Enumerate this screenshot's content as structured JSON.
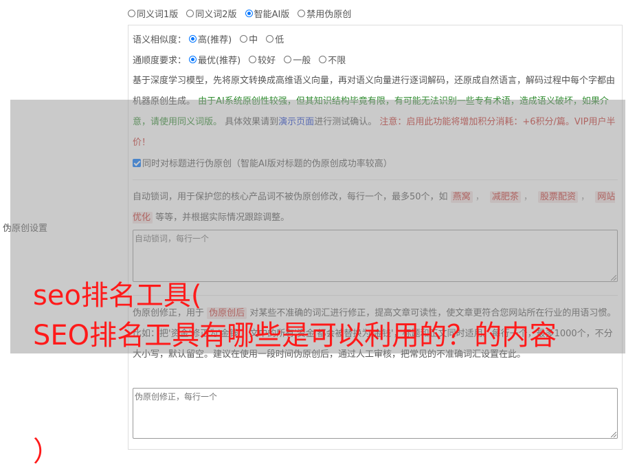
{
  "mode_options": [
    {
      "label": "同义词1版",
      "checked": false
    },
    {
      "label": "同义词2版",
      "checked": false
    },
    {
      "label": "智能AI版",
      "checked": true
    },
    {
      "label": "禁用伪原创",
      "checked": false
    }
  ],
  "similarity": {
    "label": "语义相似度：",
    "options": [
      {
        "label": "高(推荐)",
        "checked": true
      },
      {
        "label": "中",
        "checked": false
      },
      {
        "label": "低",
        "checked": false
      }
    ]
  },
  "fluency": {
    "label": "通顺度要求：",
    "options": [
      {
        "label": "最优(推荐)",
        "checked": true
      },
      {
        "label": "较好",
        "checked": false
      },
      {
        "label": "一般",
        "checked": false
      },
      {
        "label": "不限",
        "checked": false
      }
    ]
  },
  "description": {
    "part1": "基于深度学习模型，先将原文转换成高维语义向量，再对语义向量进行逐词解码，还原成自然语言，解码过程中每个字都由机器原创生成。",
    "part2_green": "由于AI系统原创性较强，但其知识结构毕竟有限，有可能无法识别一些专有术语，造成语义破坏，如果介意，请使用同义词版。",
    "part3": "具体效果请到",
    "demo_link": "演示页面",
    "part4": "进行测试确认。",
    "part5_red": "注意：启用此功能将增加积分消耗：+6积分/篇。VIP用户半价！"
  },
  "title_checkbox": {
    "label": "同时对标题进行伪原创（智能AI版对标题的伪原创成功率较高）",
    "checked": true
  },
  "lock_words": {
    "intro": "自动锁词，用于保护您的核心产品词不被伪原创修改，每行一个，最多50个，如",
    "tags": [
      "燕窝",
      "减肥茶",
      "股票配资",
      "网站优化"
    ],
    "outro": "等等，并根据实际情况跟踪调整。",
    "placeholder": "自动锁词，每行一个"
  },
  "correction": {
    "intro": "伪原创修正，用于",
    "tag": "伪原创后",
    "text": "对某些不准确的词汇进行修正，提高文章可读性，使文章更符合您网站所在行业的用语习惯。比如：把'资金'修正为'金钱'，文中的所有'资金'都会被替换为'金钱'，标题和正文同时适用。每行一个，最多1000个，不分大小写，默认留空。建议在使用一段时间伪原创后，通过人工审核，把常见的不准确词汇设置在此。",
    "placeholder": "伪原创修正，每行一个"
  },
  "side_label": "伪原创设置",
  "watermark": {
    "line1": "seo排名工具(",
    "line2": "SEO排名工具有哪些是可以利用的？的内容",
    "line3": "）"
  }
}
